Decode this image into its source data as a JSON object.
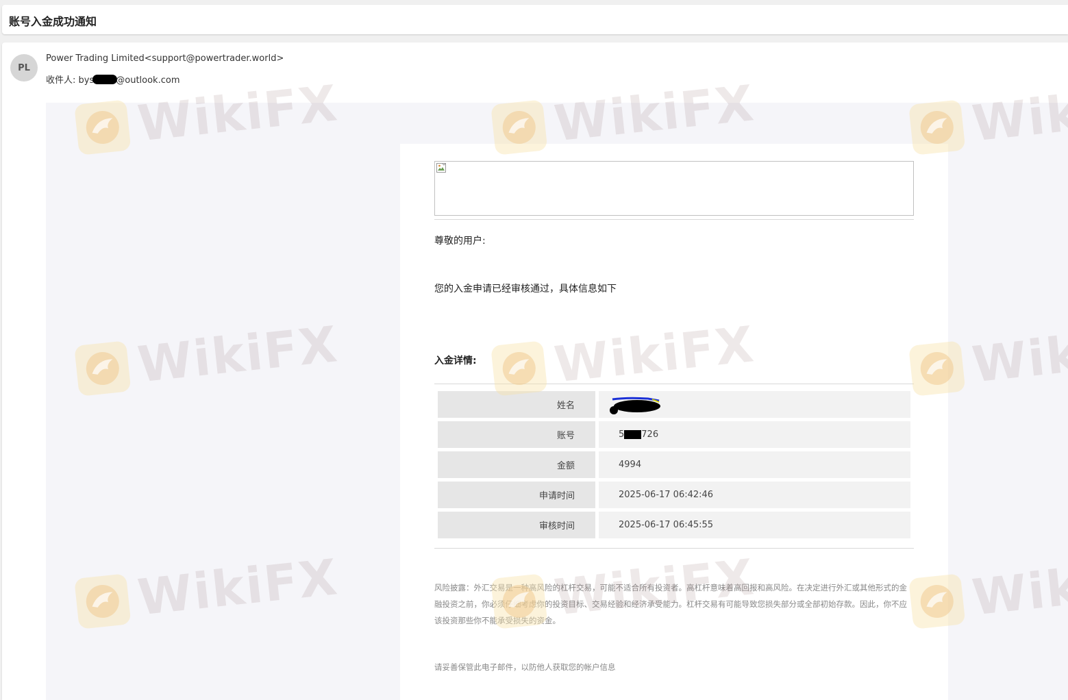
{
  "subject": "账号入金成功通知",
  "sender": {
    "avatar_initials": "PL",
    "from": "Power Trading Limited<support@powertrader.world>",
    "to_label": "收件人:",
    "to_prefix": "bys",
    "to_suffix": "@outlook.com"
  },
  "email": {
    "greeting": "尊敬的用户:",
    "intro": "您的入金申请已经审核通过，具体信息如下",
    "details_heading": "入金详情:",
    "details": {
      "name_label": "姓名",
      "account_label": "账号",
      "account_prefix": "5",
      "account_suffix": "726",
      "amount_label": "金额",
      "amount_value": "4994",
      "apply_time_label": "申请时间",
      "apply_time_value": "2025-06-17 06:42:46",
      "review_time_label": "审核时间",
      "review_time_value": "2025-06-17 06:45:55"
    },
    "disclaimer": "风险披露：外汇交易是一种高风险的杠杆交易，可能不适合所有投资者。高杠杆意味着高回报和高风险。在决定进行外汇或其他形式的金融投资之前，你必须仔细考虑你的投资目标、交易经验和经济承受能力。杠杆交易有可能导致您损失部分或全部初始存款。因此，你不应该投资那些你不能承受损失的资金。",
    "footer_note": "请妥善保管此电子邮件，以防他人获取您的帐户信息"
  },
  "watermark": {
    "text": "WikiFX",
    "badge_color": "#f8e2aa",
    "text_color": "#967878"
  }
}
